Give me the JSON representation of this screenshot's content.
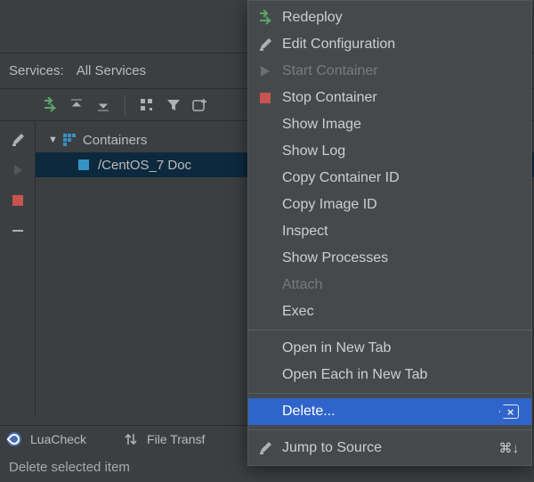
{
  "services": {
    "label": "Services:",
    "filter": "All Services"
  },
  "tree": {
    "root_label": "Containers",
    "item_label": "/CentOS_7 Doc"
  },
  "left_rail_icons": [
    "pencil-icon",
    "play-icon",
    "stop-icon",
    "minus-icon"
  ],
  "status": {
    "luacheck": "LuaCheck",
    "file_transfer": "File Transf"
  },
  "hint": "Delete selected item",
  "context_menu": {
    "items": [
      {
        "id": "redeploy",
        "label": "Redeploy",
        "icon": "redeploy-icon",
        "enabled": true
      },
      {
        "id": "edit-config",
        "label": "Edit Configuration",
        "icon": "pencil-icon",
        "enabled": true
      },
      {
        "id": "start",
        "label": "Start Container",
        "icon": "play-icon",
        "enabled": false
      },
      {
        "id": "stop",
        "label": "Stop Container",
        "icon": "stop-icon",
        "enabled": true
      },
      {
        "id": "show-image",
        "label": "Show Image",
        "icon": "",
        "enabled": true
      },
      {
        "id": "show-log",
        "label": "Show Log",
        "icon": "",
        "enabled": true
      },
      {
        "id": "copy-cid",
        "label": "Copy Container ID",
        "icon": "",
        "enabled": true
      },
      {
        "id": "copy-iid",
        "label": "Copy Image ID",
        "icon": "",
        "enabled": true
      },
      {
        "id": "inspect",
        "label": "Inspect",
        "icon": "",
        "enabled": true
      },
      {
        "id": "show-proc",
        "label": "Show Processes",
        "icon": "",
        "enabled": true
      },
      {
        "id": "attach",
        "label": "Attach",
        "icon": "",
        "enabled": false
      },
      {
        "id": "exec",
        "label": "Exec",
        "icon": "",
        "enabled": true
      },
      {
        "sep": true
      },
      {
        "id": "open-tab",
        "label": "Open in New Tab",
        "icon": "",
        "enabled": true
      },
      {
        "id": "open-each",
        "label": "Open Each in New Tab",
        "icon": "",
        "enabled": true
      },
      {
        "sep": true
      },
      {
        "id": "delete",
        "label": "Delete...",
        "icon": "",
        "enabled": true,
        "hover": true,
        "shortcut_icon": "backspace-icon"
      },
      {
        "sep": true
      },
      {
        "id": "jump",
        "label": "Jump to Source",
        "icon": "pencil-icon",
        "enabled": true,
        "shortcut": "⌘↓"
      }
    ]
  }
}
